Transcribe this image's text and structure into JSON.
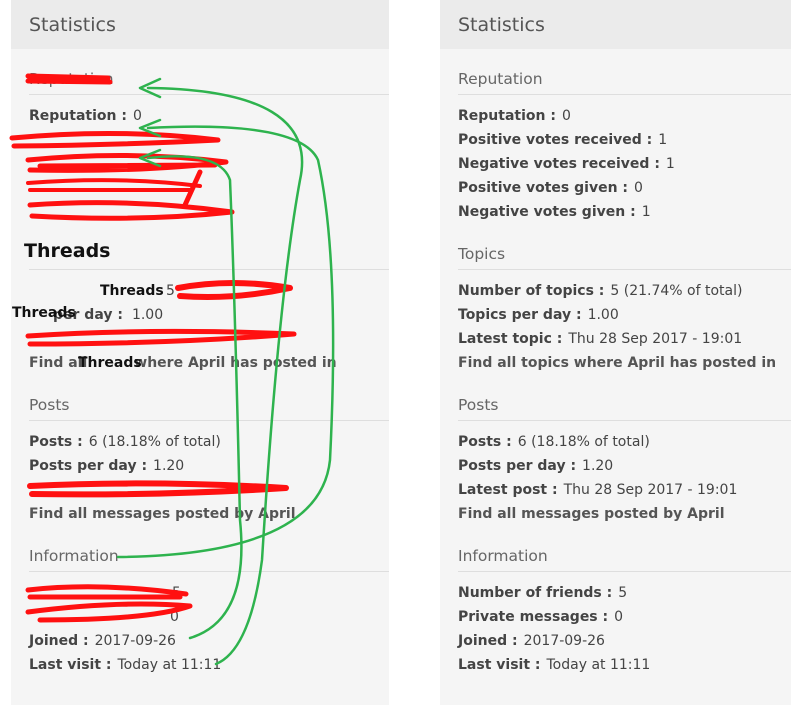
{
  "colors": {
    "scribble_red": "#ff0000",
    "arrow_green": "#22aa44"
  },
  "left": {
    "title": "Statistics",
    "reputation": {
      "heading": "Reputation",
      "rep_label": "Reputation :",
      "rep_value": "0"
    },
    "topics": {
      "per_day_label": "per day :",
      "per_day_value": "1.00",
      "number_value": "5",
      "find_all_prefix": "Find all",
      "find_all_suffix": "where April has posted in"
    },
    "posts": {
      "heading": "Posts",
      "posts_label": "Posts :",
      "posts_value": "6 (18.18% of total)",
      "per_day_label": "Posts per day :",
      "per_day_value": "1.20",
      "find_all": "Find all messages posted by April"
    },
    "information": {
      "heading": "Information",
      "friends_value": "5",
      "private_value": "0",
      "joined_label": "Joined :",
      "joined_value": "2017-09-26",
      "last_visit_label": "Last visit :",
      "last_visit_value": "Today at 11:11"
    },
    "threads_annotations": [
      "Threads",
      "Threads",
      "Threads",
      "Threads"
    ]
  },
  "right": {
    "title": "Statistics",
    "reputation": {
      "heading": "Reputation",
      "rows": [
        {
          "label": "Reputation :",
          "value": "0"
        },
        {
          "label": "Positive votes received :",
          "value": "1"
        },
        {
          "label": "Negative votes received :",
          "value": "1"
        },
        {
          "label": "Positive votes given :",
          "value": "0"
        },
        {
          "label": "Negative votes given :",
          "value": "1"
        }
      ]
    },
    "topics": {
      "heading": "Topics",
      "rows": [
        {
          "label": "Number of topics :",
          "value": "5 (21.74% of total)"
        },
        {
          "label": "Topics per day :",
          "value": "1.00"
        },
        {
          "label": "Latest topic :",
          "value": "Thu 28 Sep 2017 - 19:01"
        }
      ],
      "find_all": "Find all topics where April has posted in"
    },
    "posts": {
      "heading": "Posts",
      "rows": [
        {
          "label": "Posts :",
          "value": "6 (18.18% of total)"
        },
        {
          "label": "Posts per day :",
          "value": "1.20"
        },
        {
          "label": "Latest post :",
          "value": "Thu 28 Sep 2017 - 19:01"
        }
      ],
      "find_all": "Find all messages posted by April"
    },
    "information": {
      "heading": "Information",
      "rows": [
        {
          "label": "Number of friends :",
          "value": "5"
        },
        {
          "label": "Private messages :",
          "value": "0"
        },
        {
          "label": "Joined :",
          "value": "2017-09-26"
        },
        {
          "label": "Last visit :",
          "value": "Today at 11:11"
        }
      ]
    }
  }
}
